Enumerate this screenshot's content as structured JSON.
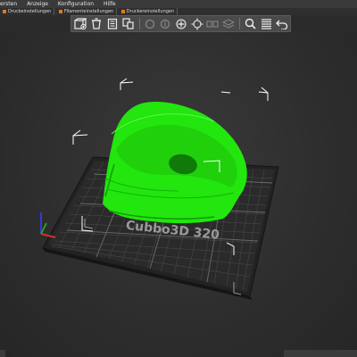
{
  "menubar": {
    "items": [
      "ersten",
      "Anzeige",
      "Konfiguration",
      "Hilfe"
    ]
  },
  "tabs": {
    "items": [
      "Druckeinstellungen",
      "Filamenteinstellungen",
      "Druckereinstellungen"
    ]
  },
  "toolbar": {
    "icons": [
      "add-icon",
      "delete-icon",
      "delete-all-icon",
      "arrange-icon",
      "copy-icon",
      "paste-icon",
      "add-instance-icon",
      "remove-instance-icon",
      "split-icon",
      "layers-icon",
      "search-icon",
      "list-icon",
      "undo-icon"
    ]
  },
  "bed": {
    "label": "Cubbo3D 320"
  },
  "colors": {
    "model": "#22e60e",
    "bed_plate": "#2a2a2a",
    "grid": "#4d4d4d",
    "background": "#2b2b2b"
  }
}
